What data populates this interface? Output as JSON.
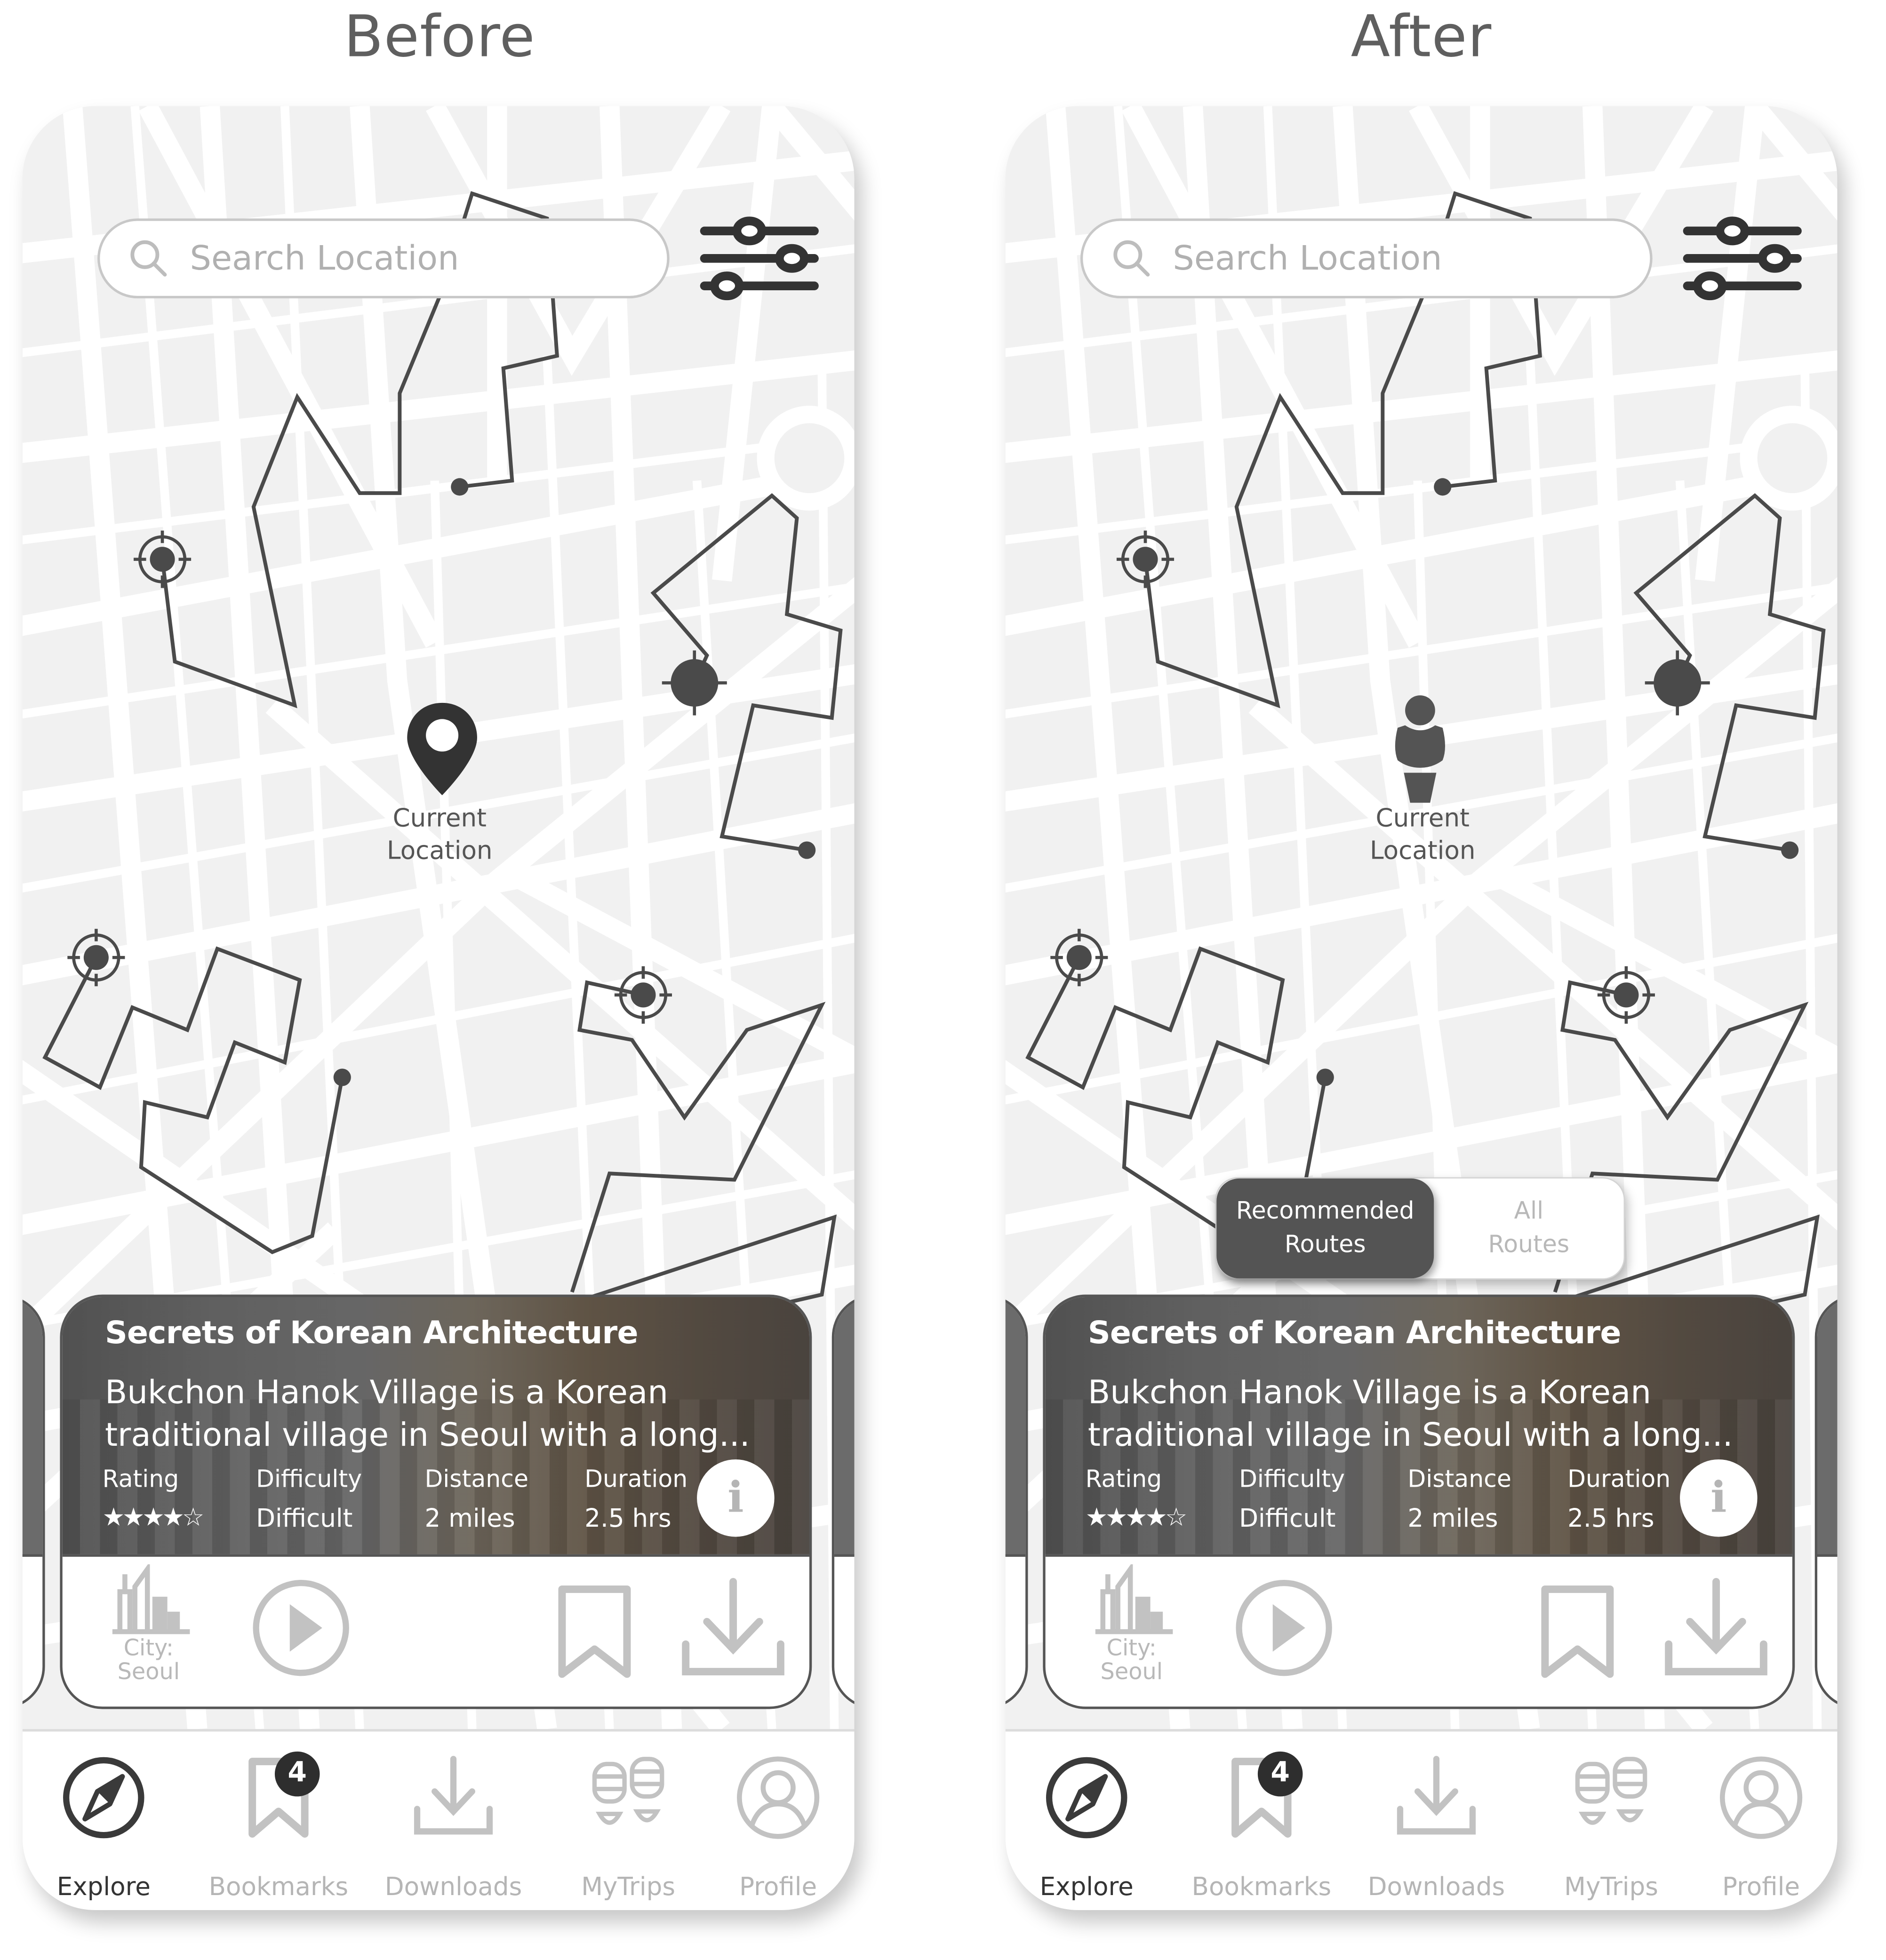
{
  "columns": [
    {
      "heading": "Before",
      "search": {
        "placeholder": "Search Location"
      },
      "current_location": {
        "label_line1": "Current",
        "label_line2": "Location",
        "marker": "map-pin-icon"
      },
      "route_toggle": null,
      "card": {
        "title": "Secrets of Korean Architecture",
        "description": "Bukchon Hanok Village is a Korean traditional village in Seoul with a long...",
        "stats": {
          "rating_label": "Rating",
          "rating_value": 4,
          "rating_max": 5,
          "rating_stars": "★★★★☆",
          "difficulty_label": "Difficulty",
          "difficulty_value": "Difficult",
          "distance_label": "Distance",
          "distance_value": "2 miles",
          "duration_label": "Duration",
          "duration_value": "2.5 hrs"
        },
        "info_glyph": "i",
        "city_label_line1": "City:",
        "city_label_line2": "Seoul"
      },
      "nav": {
        "items": [
          {
            "label": "Explore",
            "icon": "compass-icon",
            "active": true
          },
          {
            "label": "Bookmarks",
            "icon": "bookmark-icon",
            "active": false,
            "badge": "4"
          },
          {
            "label": "Downloads",
            "icon": "download-icon",
            "active": false
          },
          {
            "label": "MyTrips",
            "icon": "footsteps-icon",
            "active": false
          },
          {
            "label": "Profile",
            "icon": "profile-icon",
            "active": false
          }
        ]
      }
    },
    {
      "heading": "After",
      "search": {
        "placeholder": "Search Location"
      },
      "current_location": {
        "label_line1": "Current",
        "label_line2": "Location",
        "marker": "person-icon"
      },
      "route_toggle": {
        "active_line1": "Recommended",
        "active_line2": "Routes",
        "inactive_line1": "All",
        "inactive_line2": "Routes",
        "selected": "Recommended Routes"
      },
      "card": {
        "title": "Secrets of Korean Architecture",
        "description": "Bukchon Hanok Village is a Korean traditional village in Seoul with a long...",
        "stats": {
          "rating_label": "Rating",
          "rating_value": 4,
          "rating_max": 5,
          "rating_stars": "★★★★☆",
          "difficulty_label": "Difficulty",
          "difficulty_value": "Difficult",
          "distance_label": "Distance",
          "distance_value": "2 miles",
          "duration_label": "Duration",
          "duration_value": "2.5 hrs"
        },
        "info_glyph": "i",
        "city_label_line1": "City:",
        "city_label_line2": "Seoul"
      },
      "nav": {
        "items": [
          {
            "label": "Explore",
            "icon": "compass-icon",
            "active": true
          },
          {
            "label": "Bookmarks",
            "icon": "bookmark-icon",
            "active": false,
            "badge": "4"
          },
          {
            "label": "Downloads",
            "icon": "download-icon",
            "active": false
          },
          {
            "label": "MyTrips",
            "icon": "footsteps-icon",
            "active": false
          },
          {
            "label": "Profile",
            "icon": "profile-icon",
            "active": false
          }
        ]
      }
    }
  ],
  "colors": {
    "map_block": "#f1f1f1",
    "road": "#ffffff",
    "route_line": "#4a4a4a",
    "toggle_active": "#545454",
    "icon_inactive": "#c2c2c2",
    "icon_active": "#3a3a3a",
    "badge": "#2e2e2e"
  }
}
